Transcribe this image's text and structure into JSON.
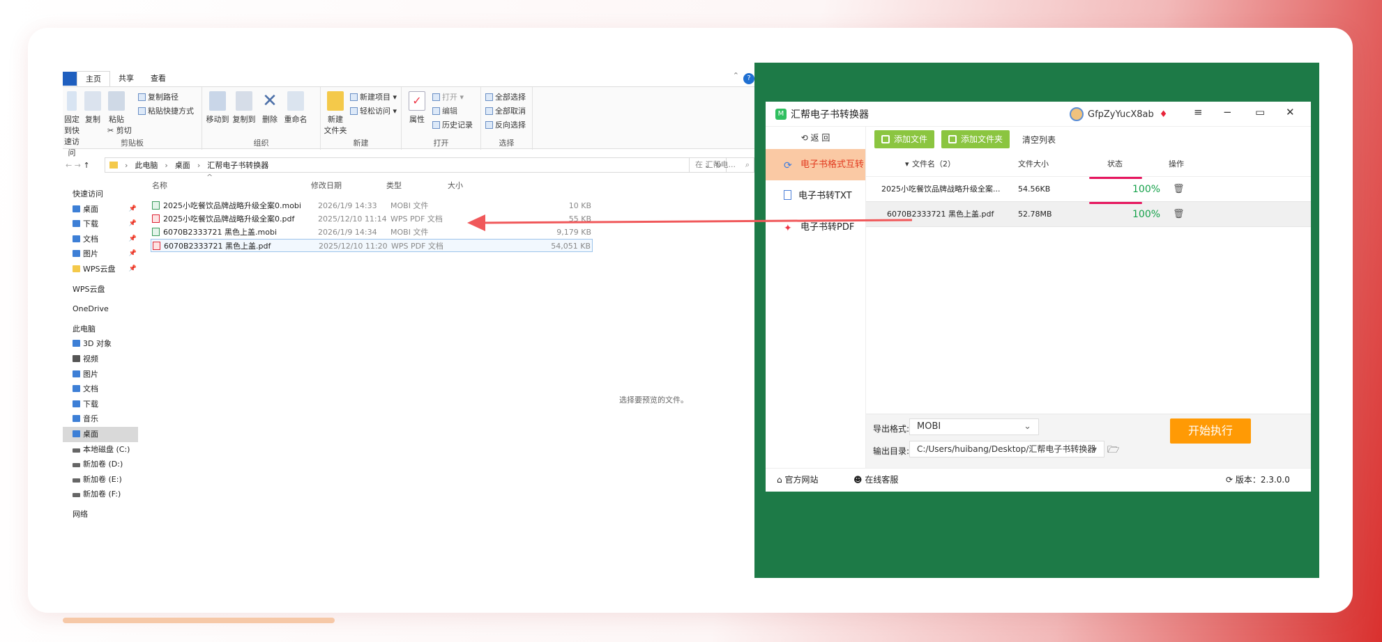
{
  "explorer": {
    "ribbon_tabs": [
      "主页",
      "共享",
      "查看"
    ],
    "clipboard": {
      "pin": "固定到快速访问",
      "copy": "复制",
      "paste": "粘贴",
      "copy_path": "复制路径",
      "paste_shortcut": "粘贴快捷方式",
      "cut": "剪切",
      "label": "剪贴板"
    },
    "organize": {
      "move_to": "移动到",
      "copy_to": "复制到",
      "delete": "删除",
      "rename": "重命名",
      "label": "组织"
    },
    "new": {
      "new_folder": "新建\n文件夹",
      "new_item": "新建项目",
      "easy_access": "轻松访问",
      "label": "新建"
    },
    "open": {
      "properties": "属性",
      "open": "打开",
      "edit": "编辑",
      "history": "历史记录",
      "label": "打开"
    },
    "select": {
      "select_all": "全部选择",
      "select_none": "全部取消",
      "invert": "反向选择",
      "label": "选择"
    },
    "breadcrumbs": [
      "此电脑",
      "桌面",
      "汇帮电子书转换器"
    ],
    "search_placeholder": "在 汇帮电...",
    "nav": [
      {
        "label": "快速访问"
      },
      {
        "label": "桌面"
      },
      {
        "label": "下载"
      },
      {
        "label": "文档"
      },
      {
        "label": "图片"
      },
      {
        "label": "WPS云盘"
      },
      {
        "label": "WPS云盘"
      },
      {
        "label": "OneDrive"
      },
      {
        "label": "此电脑"
      },
      {
        "label": "3D 对象"
      },
      {
        "label": "视频"
      },
      {
        "label": "图片"
      },
      {
        "label": "文档"
      },
      {
        "label": "下载"
      },
      {
        "label": "音乐"
      },
      {
        "label": "桌面"
      },
      {
        "label": "本地磁盘 (C:)"
      },
      {
        "label": "新加卷 (D:)"
      },
      {
        "label": "新加卷 (E:)"
      },
      {
        "label": "新加卷 (F:)"
      },
      {
        "label": "网络"
      }
    ],
    "columns": {
      "name": "名称",
      "date": "修改日期",
      "type": "类型",
      "size": "大小"
    },
    "files": [
      {
        "name": "2025小吃餐饮品牌战略升级全案0.mobi",
        "date": "2026/1/9 14:33",
        "type": "MOBI 文件",
        "size": "10 KB"
      },
      {
        "name": "2025小吃餐饮品牌战略升级全案0.pdf",
        "date": "2025/12/10 11:14",
        "type": "WPS PDF 文档",
        "size": "55 KB"
      },
      {
        "name": "6070B2333721 黑色上盖.mobi",
        "date": "2026/1/9 14:34",
        "type": "MOBI 文件",
        "size": "9,179 KB"
      },
      {
        "name": "6070B2333721 黑色上盖.pdf",
        "date": "2025/12/10 11:20",
        "type": "WPS PDF 文档",
        "size": "54,051 KB"
      }
    ],
    "preview_text": "选择要预览的文件。"
  },
  "app": {
    "title": "汇帮电子书转换器",
    "username": "GfpZyYucX8ab",
    "back_label": "返  回",
    "sidebar": [
      {
        "label": "电子书格式互转",
        "active": true
      },
      {
        "label": "电子书转TXT",
        "active": false
      },
      {
        "label": "电子书转PDF",
        "active": false
      }
    ],
    "toolbar": {
      "add_file": "添加文件",
      "add_folder": "添加文件夹",
      "clear": "清空列表"
    },
    "table_header": {
      "name": "文件名（2）",
      "size": "文件大小",
      "status": "状态",
      "action": "操作"
    },
    "rows": [
      {
        "name": "2025小吃餐饮品牌战略升级全案...",
        "size": "54.56KB",
        "progress": "100%"
      },
      {
        "name": "6070B2333721 黑色上盖.pdf",
        "size": "52.78MB",
        "progress": "100%"
      }
    ],
    "export_format_label": "导出格式:",
    "export_format": "MOBI",
    "output_dir_label": "输出目录:",
    "output_dir": "C:/Users/huibang/Desktop/汇帮电子书转换器",
    "run_label": "开始执行",
    "footer": {
      "website": "官方网站",
      "support": "在线客服",
      "version": "版本：2.3.0.0"
    },
    "colors": {
      "accent": "#ff9a05",
      "green_btn": "#8bc540",
      "active_tab": "#fac9a4",
      "progress": "#e6155d",
      "bg_green": "#1d7a47"
    }
  }
}
